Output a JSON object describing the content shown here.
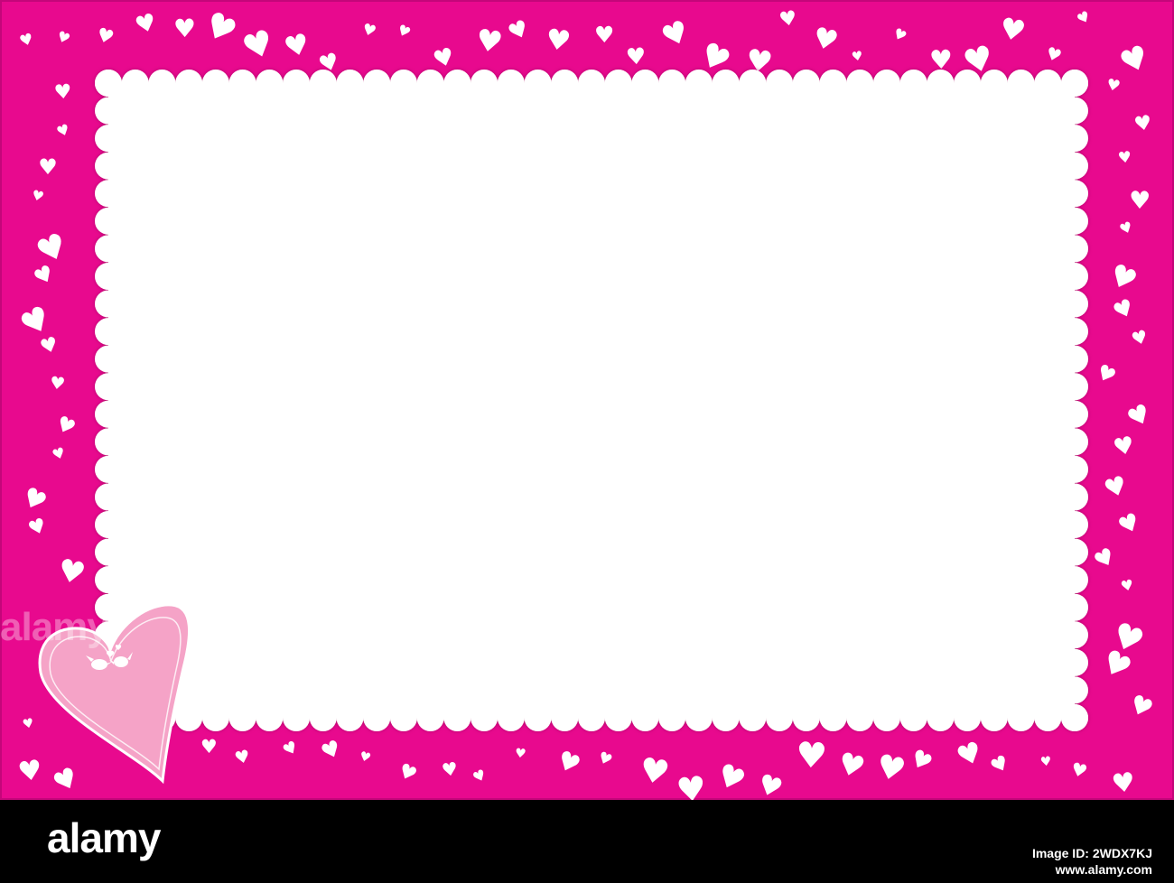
{
  "palette": {
    "frame_pink": "#e8098e",
    "paper_white": "#ffffff",
    "corner_heart_fill": "#f5a3c7",
    "footer_black": "#000000"
  },
  "decorations": {
    "background": "scattered-white-hearts",
    "center_panel": "scalloped-white-card",
    "corner_ornament": "pink-heart-with-two-kissing-birds"
  },
  "watermark": {
    "text": "alamy"
  },
  "footer": {
    "brand": "alamy",
    "image_id_label": "Image ID: 2WDX7KJ",
    "site": "www.alamy.com"
  }
}
